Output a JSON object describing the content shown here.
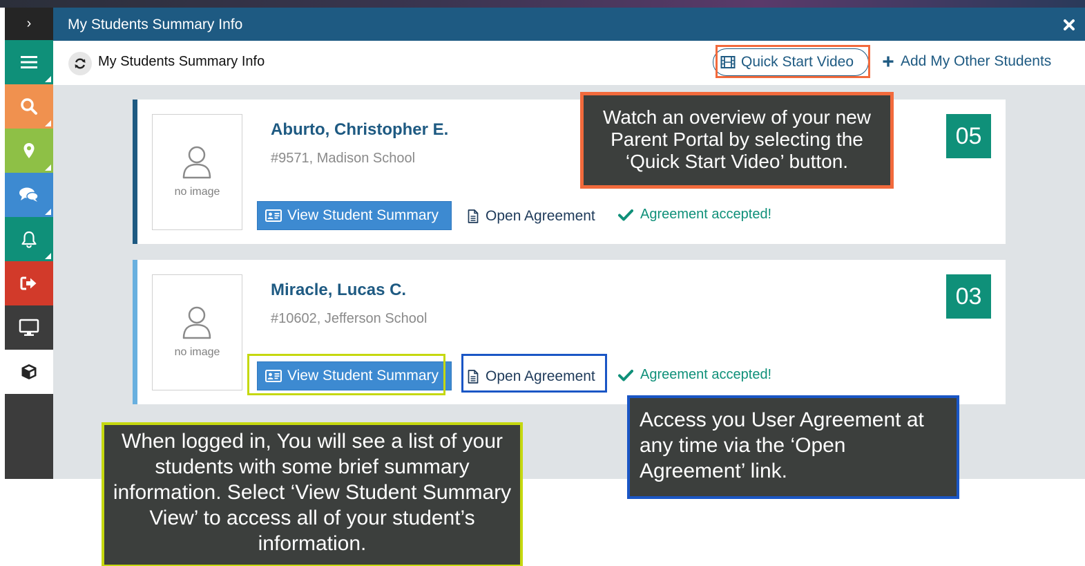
{
  "window": {
    "title": "My Students Summary Info"
  },
  "sidebar": {
    "items": [
      {
        "name": "toggle",
        "icon": "chevron-right-icon",
        "glyph": "›",
        "color": "#252525"
      },
      {
        "name": "menu",
        "icon": "menu-icon",
        "color": "#0f9079"
      },
      {
        "name": "search",
        "icon": "search-icon",
        "color": "#f0914f"
      },
      {
        "name": "map",
        "icon": "map-marker-icon",
        "color": "#8ec046"
      },
      {
        "name": "messages",
        "icon": "chat-icon",
        "color": "#3d8ad1"
      },
      {
        "name": "notifications",
        "icon": "bell-icon",
        "color": "#0f9079"
      },
      {
        "name": "logout",
        "icon": "sign-out-icon",
        "color": "#d23a2a"
      },
      {
        "name": "monitor",
        "icon": "monitor-icon",
        "color": "#3c3c3c"
      },
      {
        "name": "module",
        "icon": "cube-icon",
        "color": "#ffffff"
      }
    ]
  },
  "toolbar": {
    "title": "My Students Summary Info",
    "quick_start_label": "Quick Start Video",
    "add_students_label": "Add My Other Students"
  },
  "students": [
    {
      "name": "Aburto, Christopher E.",
      "info": "#9571, Madison School",
      "photo_label": "no image",
      "grade": "05",
      "view_label": "View Student Summary",
      "agreement_label": "Open Agreement",
      "status_label": "Agreement accepted!"
    },
    {
      "name": "Miracle, Lucas C.",
      "info": "#10602, Jefferson School",
      "photo_label": "no image",
      "grade": "03",
      "view_label": "View Student Summary",
      "agreement_label": "Open Agreement",
      "status_label": "Agreement accepted!"
    }
  ],
  "callouts": {
    "quick_start": "Watch an overview of your new Parent Portal by selecting the ‘Quick Start Video’ button.",
    "student_list": "When logged in, You will see a list of your students with some brief summary information.  Select ‘View Student Summary View’ to access all of your student’s information.",
    "agreement": "Access you User Agreement at any time via the ‘Open Agreement’ link."
  },
  "colors": {
    "header": "#1e5a82",
    "accent_teal": "#0f9079",
    "button_blue": "#3d8ad1",
    "highlight_orange": "#f26a3c",
    "highlight_green": "#c5d80f",
    "highlight_blue": "#1a56c5"
  }
}
